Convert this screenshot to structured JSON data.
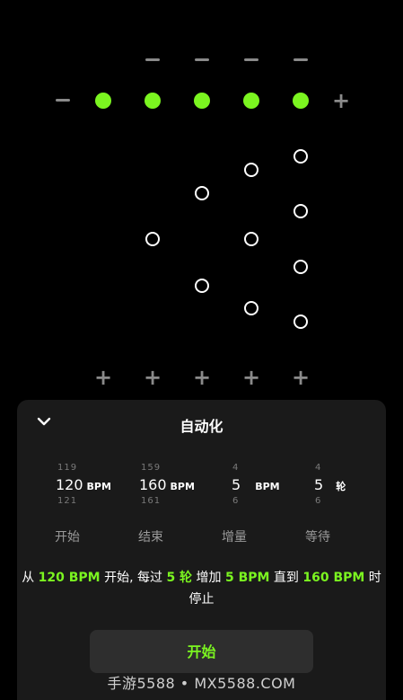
{
  "colors": {
    "accent": "#7BF520",
    "sheet_bg": "#1a1a1a"
  },
  "icons": {
    "minus": "minus-icon",
    "plus": "plus-icon",
    "collapse": "chevron-down-icon"
  },
  "sheet": {
    "title": "自动化",
    "columns": [
      {
        "prev": "119",
        "value": "120",
        "unit": "BPM",
        "next": "121",
        "label": "开始"
      },
      {
        "prev": "159",
        "value": "160",
        "unit": "BPM",
        "next": "161",
        "label": "结束"
      },
      {
        "prev": "4",
        "value": "5",
        "unit": "BPM",
        "next": "6",
        "label": "增量"
      },
      {
        "prev": "4",
        "value": "5",
        "unit": "轮",
        "next": "6",
        "label": "等待"
      }
    ],
    "description": {
      "p1": "从 ",
      "v1": "120 BPM",
      "p2": " 开始, 每过 ",
      "v2": "5 轮",
      "p3": " 增加 ",
      "v3": "5 BPM",
      "p4": " 直到 ",
      "v4": "160 BPM",
      "p5": " 时停止"
    },
    "start_label": "开始"
  },
  "watermark": "手游5588 • MX5588.COM"
}
